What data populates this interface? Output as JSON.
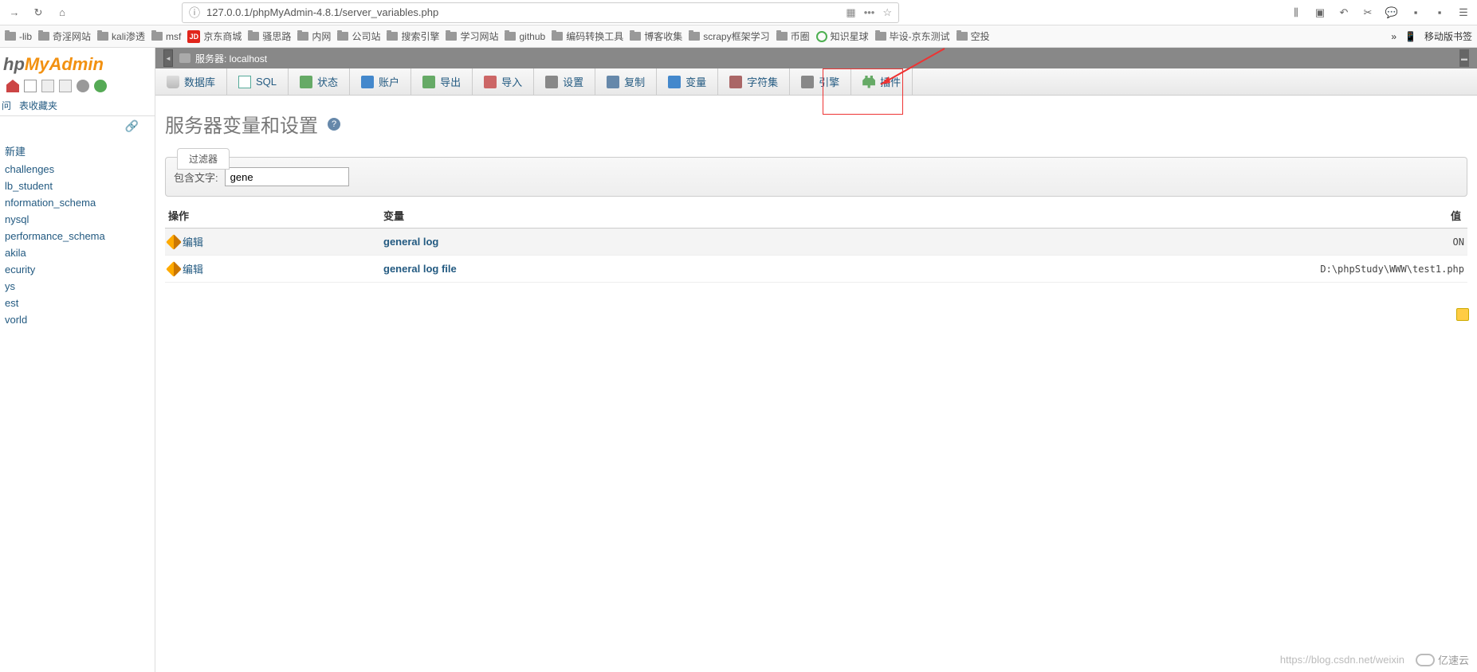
{
  "browser": {
    "url": "127.0.0.1/phpMyAdmin-4.8.1/server_variables.php"
  },
  "bookmarks": [
    {
      "label": "-lib",
      "icon": "folder"
    },
    {
      "label": "奇淫网站",
      "icon": "folder"
    },
    {
      "label": "kali渗透",
      "icon": "folder"
    },
    {
      "label": "msf",
      "icon": "folder"
    },
    {
      "label": "京东商城",
      "icon": "jd"
    },
    {
      "label": "骚思路",
      "icon": "folder"
    },
    {
      "label": "内网",
      "icon": "folder"
    },
    {
      "label": "公司站",
      "icon": "folder"
    },
    {
      "label": "搜索引擎",
      "icon": "folder"
    },
    {
      "label": "学习网站",
      "icon": "folder"
    },
    {
      "label": "github",
      "icon": "folder"
    },
    {
      "label": "编码转换工具",
      "icon": "folder"
    },
    {
      "label": "博客收集",
      "icon": "folder"
    },
    {
      "label": "scrapy框架学习",
      "icon": "folder"
    },
    {
      "label": "币圈",
      "icon": "folder"
    },
    {
      "label": "知识星球",
      "icon": "zsxq"
    },
    {
      "label": "毕设-京东测试",
      "icon": "folder"
    },
    {
      "label": "空投",
      "icon": "folder"
    }
  ],
  "bookmarks_right": {
    "mobile": "移动版书签"
  },
  "sidebar": {
    "tabs": {
      "recent": "问",
      "favorites": "表收藏夹"
    },
    "dblist": [
      "新建",
      "challenges",
      "lb_student",
      "nformation_schema",
      "nysql",
      "performance_schema",
      "akila",
      "ecurity",
      "ys",
      "est",
      "vorld"
    ]
  },
  "breadcrumb": "服务器: localhost",
  "tabs": [
    {
      "label": "数据库",
      "icon": "db"
    },
    {
      "label": "SQL",
      "icon": "sql"
    },
    {
      "label": "状态",
      "icon": "status"
    },
    {
      "label": "账户",
      "icon": "users"
    },
    {
      "label": "导出",
      "icon": "export"
    },
    {
      "label": "导入",
      "icon": "import"
    },
    {
      "label": "设置",
      "icon": "settings"
    },
    {
      "label": "复制",
      "icon": "repl"
    },
    {
      "label": "变量",
      "icon": "vars"
    },
    {
      "label": "字符集",
      "icon": "charset"
    },
    {
      "label": "引擎",
      "icon": "engine"
    },
    {
      "label": "插件",
      "icon": "plugin"
    }
  ],
  "page": {
    "title": "服务器变量和设置",
    "filter_legend": "过滤器",
    "filter_label": "包含文字:",
    "filter_value": "gene",
    "columns": {
      "action": "操作",
      "variable": "变量",
      "value": "值"
    },
    "edit_label": "编辑",
    "rows": [
      {
        "name": "general log",
        "value": "ON"
      },
      {
        "name": "general log file",
        "value": "D:\\phpStudy\\WWW\\test1.php"
      }
    ]
  },
  "footer": {
    "watermark": "https://blog.csdn.net/weixin",
    "brand": "亿速云"
  }
}
